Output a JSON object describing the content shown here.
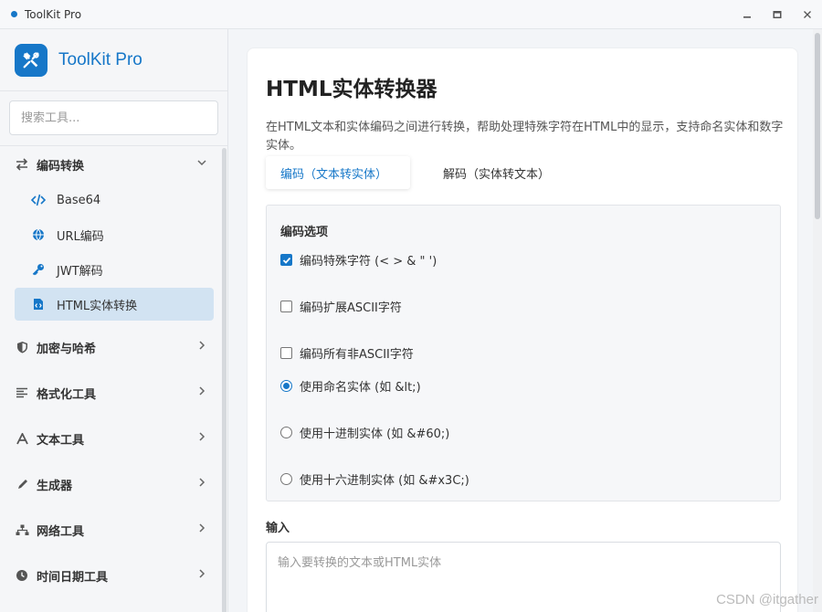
{
  "window": {
    "title": "ToolKit Pro",
    "controls": [
      "minimize",
      "maximize",
      "close"
    ]
  },
  "sidebar": {
    "logo_text": "ToolKit Pro",
    "search_placeholder": "搜索工具...",
    "groups": [
      {
        "label": "编码转换",
        "icon": "arrows-swap-icon",
        "expanded": true,
        "items": [
          {
            "label": "Base64",
            "icon": "code-icon",
            "active": false
          },
          {
            "label": "URL编码",
            "icon": "globe-icon",
            "active": false
          },
          {
            "label": "JWT解码",
            "icon": "key-icon",
            "active": false
          },
          {
            "label": "HTML实体转换",
            "icon": "file-code-icon",
            "active": true
          }
        ]
      },
      {
        "label": "加密与哈希",
        "icon": "shield-icon",
        "expanded": false
      },
      {
        "label": "格式化工具",
        "icon": "align-left-icon",
        "expanded": false
      },
      {
        "label": "文本工具",
        "icon": "font-icon",
        "expanded": false
      },
      {
        "label": "生成器",
        "icon": "pen-icon",
        "expanded": false
      },
      {
        "label": "网络工具",
        "icon": "network-icon",
        "expanded": false
      },
      {
        "label": "时间日期工具",
        "icon": "clock-icon",
        "expanded": false
      }
    ]
  },
  "main": {
    "title": "HTML实体转换器",
    "description": "在HTML文本和实体编码之间进行转换，帮助处理特殊字符在HTML中的显示，支持命名实体和数字实体。",
    "tabs": [
      {
        "label": "编码（文本转实体）",
        "active": true
      },
      {
        "label": "解码（实体转文本）",
        "active": false
      }
    ],
    "options": {
      "title": "编码选项",
      "checkboxes": [
        {
          "label": "编码特殊字符 (< > & \" ')",
          "checked": true
        },
        {
          "label": "编码扩展ASCII字符",
          "checked": false
        },
        {
          "label": "编码所有非ASCII字符",
          "checked": false
        }
      ],
      "radios": [
        {
          "label": "使用命名实体 (如 &lt;)",
          "checked": true
        },
        {
          "label": "使用十进制实体 (如 &#60;)",
          "checked": false
        },
        {
          "label": "使用十六进制实体 (如 &#x3C;)",
          "checked": false
        }
      ]
    },
    "input": {
      "label": "输入",
      "placeholder": "输入要转换的文本或HTML实体"
    }
  },
  "watermark": "CSDN @itgather",
  "colors": {
    "accent": "#1677c8",
    "active_item_bg": "#d2e3f2",
    "sidebar_bg": "#f5f6f8"
  }
}
